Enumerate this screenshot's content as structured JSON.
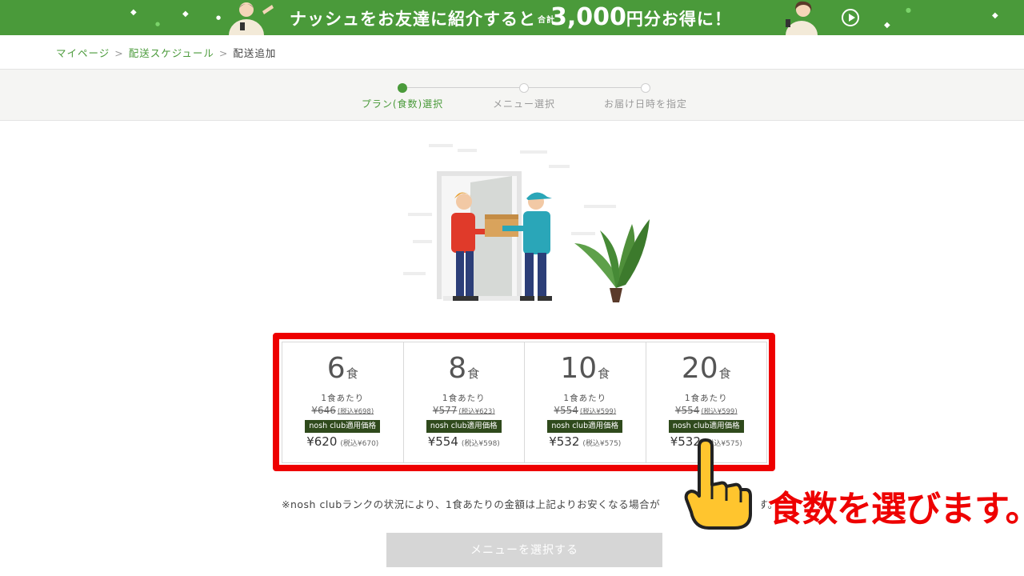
{
  "banner": {
    "text_before": "ナッシュをお友達に紹介すると",
    "text_total": "合計",
    "text_amount": "3,000",
    "text_after": "円分お得に！",
    "icon": "play-icon",
    "color": "#4a9a3a"
  },
  "breadcrumb": {
    "items": [
      "マイページ",
      "配送スケジュール"
    ],
    "current": "配送追加",
    "separator": ">"
  },
  "steps": [
    {
      "label": "プラン(食数)選択",
      "active": true
    },
    {
      "label": "メニュー選択",
      "active": false
    },
    {
      "label": "お届け日時を指定",
      "active": false
    }
  ],
  "plans": [
    {
      "count": "6",
      "unit": "食",
      "per_label": "1食あたり",
      "old_price": "¥646",
      "old_tax": "(税込¥698)",
      "badge": "nosh club適用価格",
      "price": "¥620",
      "price_tax": "(税込¥670)"
    },
    {
      "count": "8",
      "unit": "食",
      "per_label": "1食あたり",
      "old_price": "¥577",
      "old_tax": "(税込¥623)",
      "badge": "nosh club適用価格",
      "price": "¥554",
      "price_tax": "(税込¥598)"
    },
    {
      "count": "10",
      "unit": "食",
      "per_label": "1食あたり",
      "old_price": "¥554",
      "old_tax": "(税込¥599)",
      "badge": "nosh club適用価格",
      "price": "¥532",
      "price_tax": "(税込¥575)"
    },
    {
      "count": "20",
      "unit": "食",
      "per_label": "1食あたり",
      "old_price": "¥554",
      "old_tax": "(税込¥599)",
      "badge": "nosh club適用価格",
      "price": "¥532",
      "price_tax": "(税込¥575)"
    }
  ],
  "note": {
    "text": "※nosh clubランクの状況により、1食あたりの金額は上記よりお安くなる場合が",
    "tail": "す。"
  },
  "annotation": "食数を選びます。",
  "submit_label": "メニューを選択する",
  "colors": {
    "accent": "#4a9a3a",
    "highlight": "#ee0000",
    "badge": "#2f4a1c",
    "button_disabled": "#d6d6d6"
  }
}
